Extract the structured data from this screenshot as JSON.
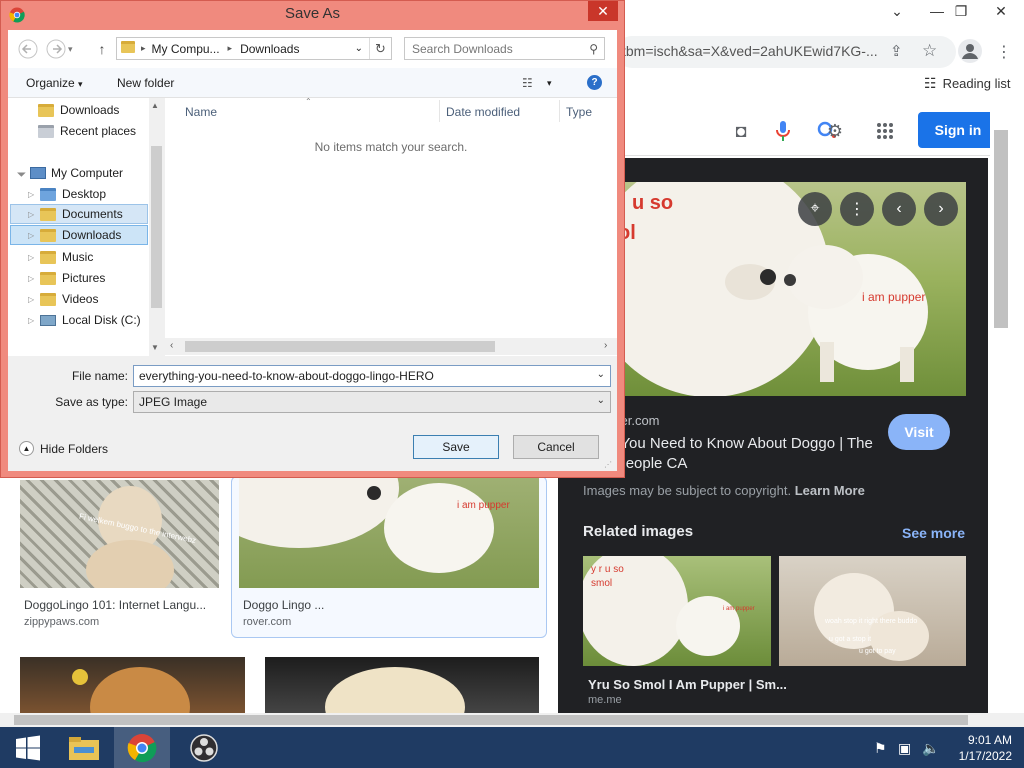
{
  "browser": {
    "url": "tbm=isch&sa=X&ved=2ahUKEwid7KG-...",
    "reading_list": "Reading list",
    "sign_in": "Sign in"
  },
  "viewer": {
    "overlay_text_1": "u so",
    "overlay_text_2": "ol",
    "overlay_text_3": "i am pupper",
    "source": "ver.com",
    "title": "thing You Need to Know About Doggo | The Dog People CA",
    "visit": "Visit",
    "copyright": "Images may be subject to copyright.",
    "learn_more": "Learn More",
    "related_heading": "Related images",
    "see_more": "See more",
    "related": [
      {
        "title": "Yru So Smol I Am Pupper | Sm...",
        "source": "me.me",
        "overlay_a": "y r u so",
        "overlay_b": "smol",
        "overlay_c": "i am pupper"
      },
      {
        "overlay_a": "woah stop it right there buddo",
        "overlay_b": "u got a stop it",
        "overlay_c": "u got to pay"
      }
    ]
  },
  "results": [
    {
      "title": "DoggoLingo 101: Internet Langu...",
      "source": "zippypaws.com",
      "overlay": "Fi welkem buggo to the interwebz"
    },
    {
      "title": "Doggo Lingo ...",
      "source": "rover.com",
      "overlay": "i am pupper"
    }
  ],
  "dialog": {
    "title": "Save As",
    "address_crumb_1": "My Compu...",
    "address_crumb_2": "Downloads",
    "search_placeholder": "Search Downloads",
    "organize": "Organize",
    "new_folder": "New folder",
    "nav": {
      "quick": [
        {
          "label": "Downloads"
        },
        {
          "label": "Recent places"
        }
      ],
      "computer": "My Computer",
      "items": [
        {
          "label": "Desktop"
        },
        {
          "label": "Documents"
        },
        {
          "label": "Downloads"
        },
        {
          "label": "Music"
        },
        {
          "label": "Pictures"
        },
        {
          "label": "Videos"
        },
        {
          "label": "Local Disk (C:)"
        }
      ]
    },
    "columns": {
      "name": "Name",
      "date": "Date modified",
      "type": "Type"
    },
    "empty_message": "No items match your search.",
    "file_name_label": "File name:",
    "file_name_value": "everything-you-need-to-know-about-doggo-lingo-HERO",
    "save_type_label": "Save as type:",
    "save_type_value": "JPEG Image",
    "hide_folders": "Hide Folders",
    "save": "Save",
    "cancel": "Cancel"
  },
  "taskbar": {
    "time": "9:01 AM",
    "date": "1/17/2022"
  },
  "colors": {
    "dialog_frame": "#f08a7e",
    "close_button": "#c9362a",
    "taskbar": "#1f3b63",
    "sign_in": "#1a73e8",
    "viewer_bg": "#202124",
    "visit": "#8ab4f8"
  },
  "icons": [
    "chrome-icon",
    "share-icon",
    "star-icon",
    "profile-icon",
    "reading-list-icon",
    "camera-icon",
    "mic-icon",
    "lens-icon",
    "apps-grid-icon",
    "lens-small-icon",
    "more-icon",
    "prev-icon",
    "next-icon",
    "back-icon",
    "forward-icon",
    "up-icon",
    "refresh-icon",
    "search-icon",
    "view-icon",
    "help-icon",
    "folder-icon",
    "computer-icon",
    "disk-icon",
    "windows-icon",
    "file-explorer-icon",
    "obs-icon",
    "flag-icon",
    "network-icon",
    "volume-icon"
  ]
}
